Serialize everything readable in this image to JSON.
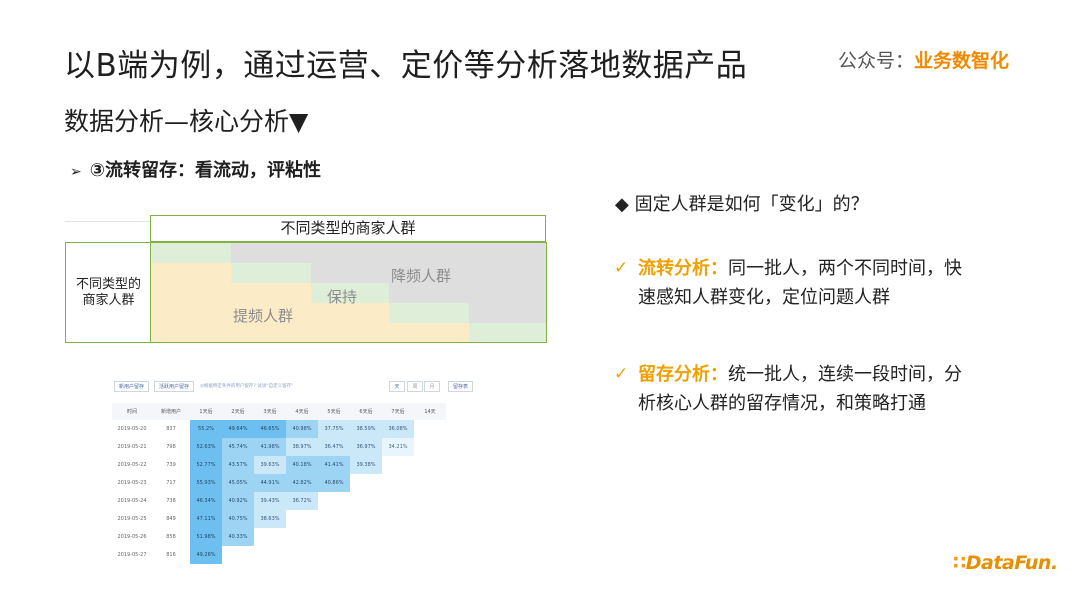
{
  "title": "以B端为例，通过运营、定价等分析落地数据产品",
  "brand": {
    "label": "公众号：",
    "name": "业务数智化"
  },
  "subtitle": "数据分析—核心分析▼",
  "bullet": {
    "marker": "➢",
    "text": "③流转留存：看流动，评粘性"
  },
  "matrix": {
    "col_header": "不同类型的商家人群",
    "row_header": "不同类型的\n商家人群",
    "labels": {
      "down": "降频人群",
      "keep": "保持",
      "up": "提频人群"
    },
    "colors": {
      "down": "#dedede",
      "keep": "#dfeed8",
      "up": "#fcebc7",
      "edge": "#7cb342"
    }
  },
  "retention": {
    "tabs": [
      "新用户留存",
      "活跃用户留存"
    ],
    "hint": "◎根据特定条件的用户留存? 试试“自定义留存”",
    "period_buttons": [
      "天",
      "周",
      "月"
    ],
    "custom_button": "留存表",
    "columns": [
      "时间",
      "新增用户",
      "1天后",
      "2天后",
      "3天后",
      "4天后",
      "5天后",
      "6天后",
      "7天后",
      "14天"
    ],
    "rows": [
      {
        "date": "2019-05-20",
        "users": "837",
        "vals": [
          "55.2%",
          "49.64%",
          "46.65%",
          "40.98%",
          "37.75%",
          "38.59%",
          "36.08%"
        ]
      },
      {
        "date": "2019-05-21",
        "users": "798",
        "vals": [
          "52.63%",
          "45.74%",
          "41.98%",
          "38.97%",
          "36.47%",
          "36.97%",
          "34.21%"
        ]
      },
      {
        "date": "2019-05-22",
        "users": "739",
        "vals": [
          "52.77%",
          "43.57%",
          "39.63%",
          "40.18%",
          "41.41%",
          "39.38%"
        ]
      },
      {
        "date": "2019-05-23",
        "users": "717",
        "vals": [
          "55.93%",
          "45.05%",
          "44.91%",
          "42.82%",
          "40.86%"
        ]
      },
      {
        "date": "2019-05-24",
        "users": "738",
        "vals": [
          "46.34%",
          "40.92%",
          "39.43%",
          "36.72%"
        ]
      },
      {
        "date": "2019-05-25",
        "users": "849",
        "vals": [
          "47.11%",
          "40.75%",
          "38.63%"
        ]
      },
      {
        "date": "2019-05-26",
        "users": "858",
        "vals": [
          "51.98%",
          "40.33%"
        ]
      },
      {
        "date": "2019-05-27",
        "users": "816",
        "vals": [
          "49.26%"
        ]
      }
    ]
  },
  "question": "◆ 固定人群是如何「变化」的？",
  "points": [
    {
      "check": "✓",
      "highlight": "流转分析：",
      "text": "同一批人，两个不同时间，快速感知人群变化，定位问题人群"
    },
    {
      "check": "✓",
      "highlight": "留存分析：",
      "text": "统一批人，连续一段时间，分析核心人群的留存情况，和策略打通"
    }
  ],
  "logo": {
    "mark": "∷",
    "text": "DataFun."
  }
}
